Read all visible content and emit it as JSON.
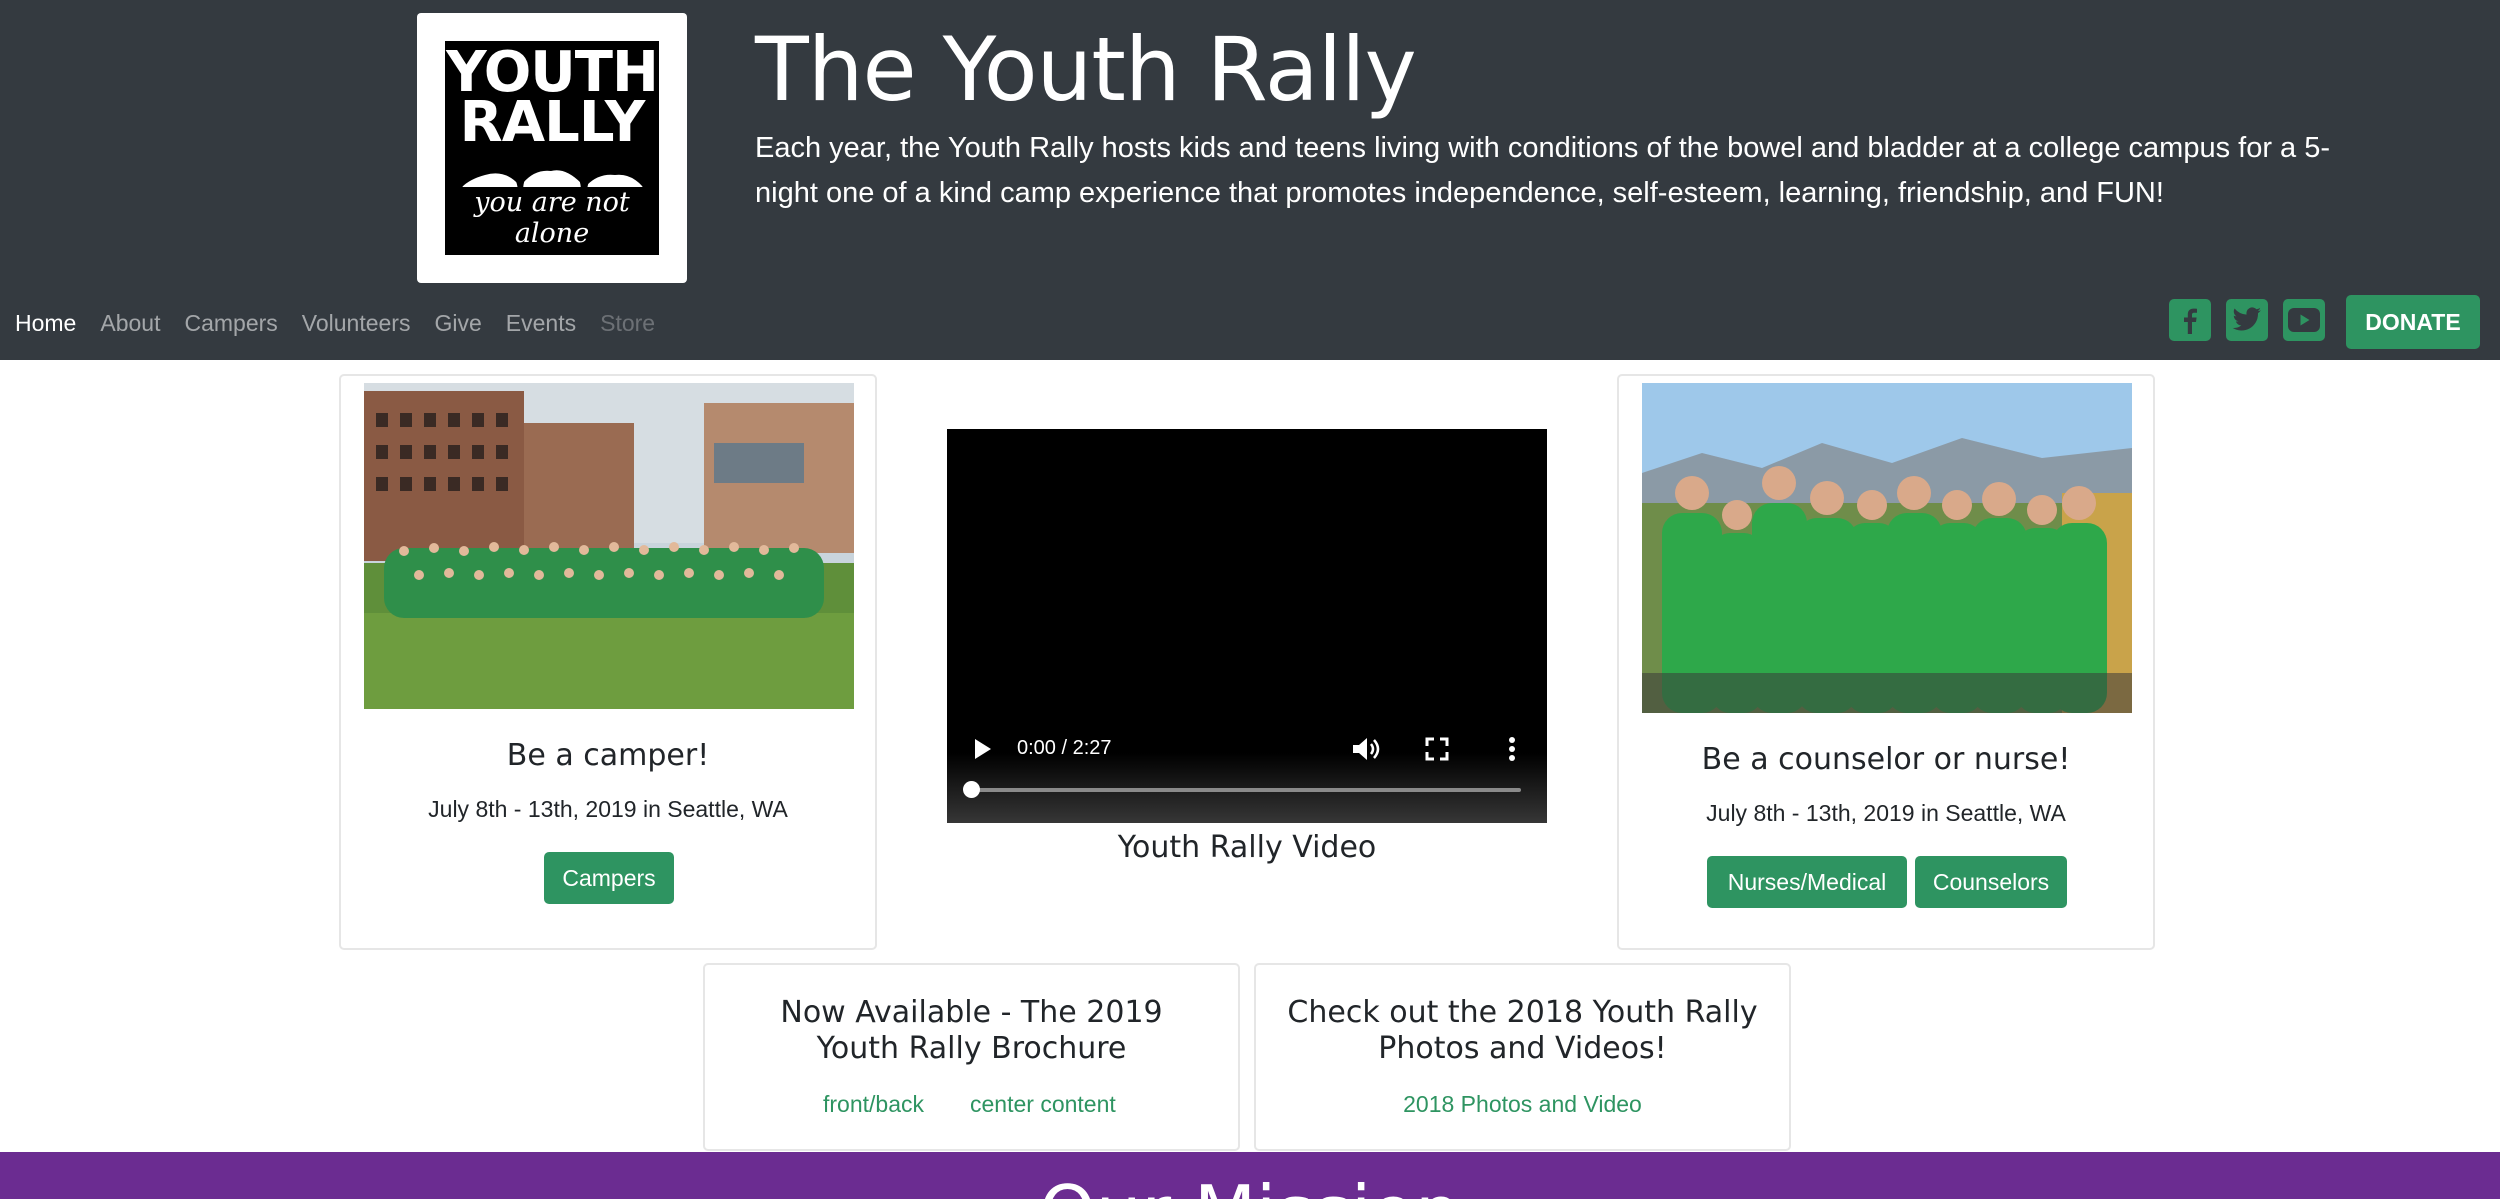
{
  "header": {
    "logo_top": "YOUTH",
    "logo_bottom": "RALLY",
    "logo_tagline": "you are not alone",
    "title": "The Youth Rally",
    "tagline": "Each year, the Youth Rally hosts kids and teens living with conditions of the bowel and bladder at a college campus for a 5-night one of a kind camp experience that promotes independence, self-esteem, learning, friendship, and FUN!"
  },
  "nav": {
    "items": [
      {
        "label": "Home",
        "state": "active"
      },
      {
        "label": "About",
        "state": "normal"
      },
      {
        "label": "Campers",
        "state": "normal"
      },
      {
        "label": "Volunteers",
        "state": "normal"
      },
      {
        "label": "Give",
        "state": "normal"
      },
      {
        "label": "Events",
        "state": "normal"
      },
      {
        "label": "Store",
        "state": "disabled"
      }
    ],
    "social": [
      "facebook-icon",
      "twitter-icon",
      "youtube-icon"
    ],
    "donate_label": "DONATE"
  },
  "cards": {
    "camper": {
      "title": "Be a camper!",
      "date": "July 8th - 13th, 2019 in Seattle, WA",
      "button": "Campers"
    },
    "video": {
      "time": "0:00 / 2:27",
      "caption": "Youth Rally Video",
      "progress": 0
    },
    "counselor": {
      "title": "Be a counselor or nurse!",
      "date": "July 8th - 13th, 2019 in Seattle, WA",
      "buttons": [
        "Nurses/Medical",
        "Counselors"
      ]
    },
    "brochure": {
      "title_line1": "Now Available - The 2019",
      "title_line2": "Youth Rally Brochure",
      "links": [
        "front/back",
        "center content"
      ]
    },
    "photos": {
      "title_line1": "Check out the 2018 Youth Rally",
      "title_line2": "Photos and Videos!",
      "link": "2018 Photos and Video"
    }
  },
  "footer": {
    "heading": "Our Mission"
  },
  "colors": {
    "header_bg": "#343a40",
    "accent_green": "#2e9461",
    "footer_purple": "#6b2c91"
  }
}
